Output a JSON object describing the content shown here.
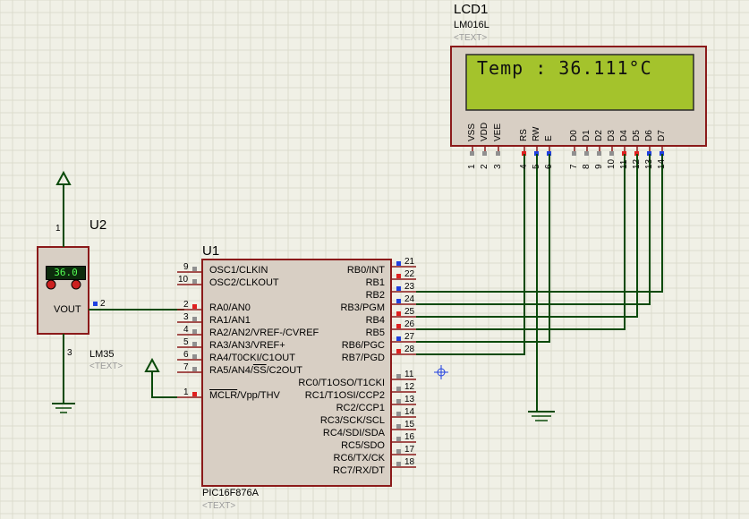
{
  "lcd": {
    "ref": "LCD1",
    "part": "LM016L",
    "text_tag": "<TEXT>",
    "display": "Temp : 36.111°C",
    "pins": [
      {
        "num": "1",
        "name": "VSS"
      },
      {
        "num": "2",
        "name": "VDD"
      },
      {
        "num": "3",
        "name": "VEE"
      },
      {
        "num": "4",
        "name": "RS"
      },
      {
        "num": "5",
        "name": "RW"
      },
      {
        "num": "6",
        "name": "E"
      },
      {
        "num": "7",
        "name": "D0"
      },
      {
        "num": "8",
        "name": "D1"
      },
      {
        "num": "9",
        "name": "D2"
      },
      {
        "num": "10",
        "name": "D3"
      },
      {
        "num": "11",
        "name": "D4"
      },
      {
        "num": "12",
        "name": "D5"
      },
      {
        "num": "13",
        "name": "D6"
      },
      {
        "num": "14",
        "name": "D7"
      }
    ]
  },
  "sensor": {
    "ref": "U2",
    "part": "LM35",
    "text_tag": "<TEXT>",
    "readout": "36.0",
    "output_label": "VOUT",
    "pin_vs": "1",
    "pin_vout": "2",
    "pin_gnd": "3"
  },
  "mcu": {
    "ref": "U1",
    "part": "PIC16F876A",
    "text_tag": "<TEXT>",
    "left_pins": [
      {
        "num": "9",
        "name": "OSC1/CLKIN"
      },
      {
        "num": "10",
        "name": "OSC2/CLKOUT"
      },
      {
        "num": "2",
        "name": "RA0/AN0"
      },
      {
        "num": "3",
        "name": "RA1/AN1"
      },
      {
        "num": "4",
        "name": "RA2/AN2/VREF-/CVREF"
      },
      {
        "num": "5",
        "name": "RA3/AN3/VREF+"
      },
      {
        "num": "6",
        "name": "RA4/T0CKI/C1OUT"
      },
      {
        "num": "7",
        "name": "RA5/AN4/SS/C2OUT"
      },
      {
        "num": "1",
        "name": "MCLR/Vpp/THV"
      }
    ],
    "right_pins": [
      {
        "num": "21",
        "name": "RB0/INT"
      },
      {
        "num": "22",
        "name": "RB1"
      },
      {
        "num": "23",
        "name": "RB2"
      },
      {
        "num": "24",
        "name": "RB3/PGM"
      },
      {
        "num": "25",
        "name": "RB4"
      },
      {
        "num": "26",
        "name": "RB5"
      },
      {
        "num": "27",
        "name": "RB6/PGC"
      },
      {
        "num": "28",
        "name": "RB7/PGD"
      },
      {
        "num": "11",
        "name": "RC0/T1OSO/T1CKI"
      },
      {
        "num": "12",
        "name": "RC1/T1OSI/CCP2"
      },
      {
        "num": "13",
        "name": "RC2/CCP1"
      },
      {
        "num": "14",
        "name": "RC3/SCK/SCL"
      },
      {
        "num": "15",
        "name": "RC4/SDI/SDA"
      },
      {
        "num": "16",
        "name": "RC5/SDO"
      },
      {
        "num": "17",
        "name": "RC6/TX/CK"
      },
      {
        "num": "18",
        "name": "RC7/RX/DT"
      }
    ]
  },
  "colors": {
    "background": "#f0f0e6",
    "grid": "#dcdccd",
    "body_fill": "#d8cfc4",
    "body_stroke": "#8b1a1a",
    "wire": "#0a4a0a",
    "lcd_screen": "#a4c32c",
    "pin_red": "#e02020",
    "pin_blue": "#2040e0",
    "pin_gray": "#909090"
  }
}
